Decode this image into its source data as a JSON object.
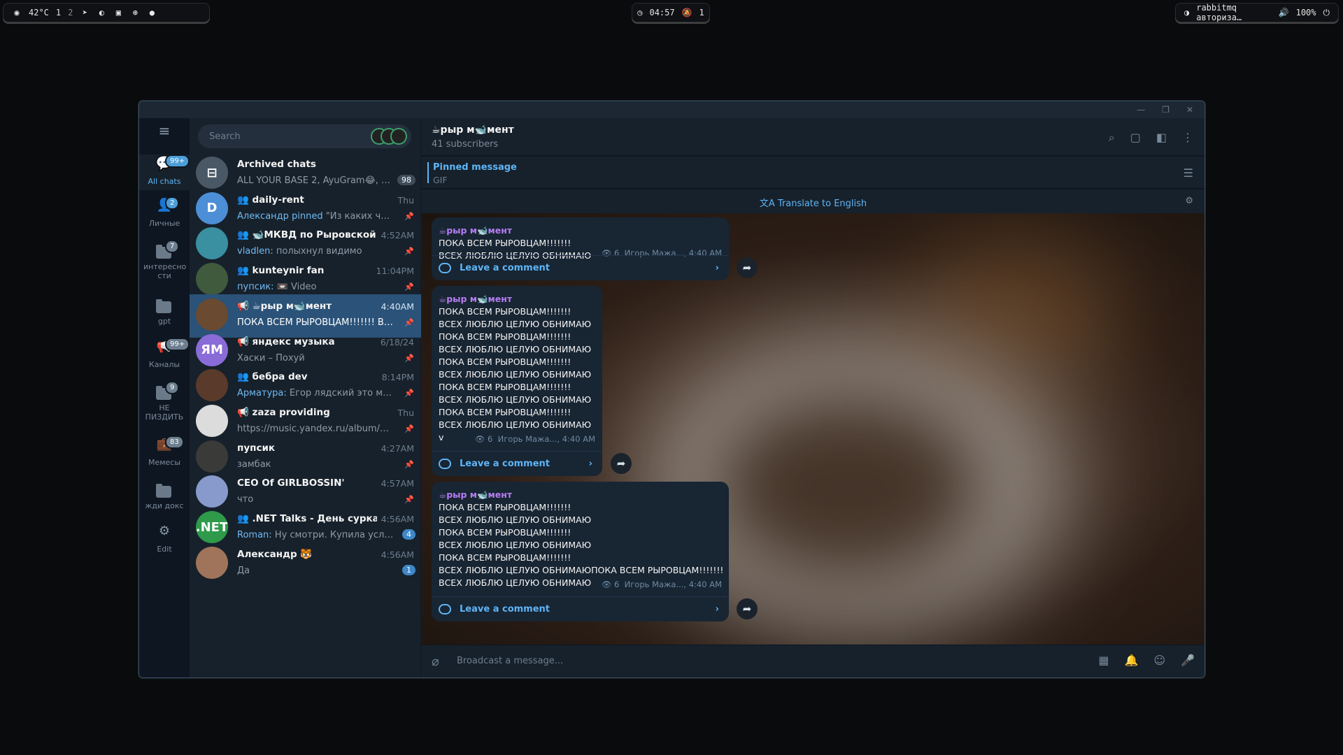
{
  "topbar": {
    "temp": "42°C",
    "ws1": "1",
    "ws2": "2",
    "clock": "04:57",
    "notif_count": "1",
    "tray_text": "rabbitmq авториза…",
    "volume": "100%"
  },
  "rail": {
    "items": [
      {
        "label": "All chats",
        "badge": "99+"
      },
      {
        "label": "Личные",
        "badge": "2"
      },
      {
        "label": "интересно сти",
        "badge": "7"
      },
      {
        "label": "gpt",
        "badge": ""
      },
      {
        "label": "Каналы",
        "badge": "99+"
      },
      {
        "label": "НЕ ПИЗДИТЬ",
        "badge": "9"
      },
      {
        "label": "Мемесы",
        "badge": "83"
      },
      {
        "label": "жди докс",
        "badge": ""
      },
      {
        "label": "Edit",
        "badge": ""
      }
    ]
  },
  "search": {
    "placeholder": "Search"
  },
  "chats": [
    {
      "name": "Archived chats",
      "time": "",
      "preview": "ALL YOUR BASE 2, AyuGram😂, NS…",
      "count": "98",
      "avatar": "⊟",
      "color": "#4a5866"
    },
    {
      "name": "👥 daily-rent",
      "time": "Thu",
      "sender": "Александр pinned ",
      "preview": "\"Из каких часте…",
      "avatar": "D",
      "color": "#4c8fd6"
    },
    {
      "name": "👥 🐋МКВД по Рыровской О…",
      "time": "4:52AM",
      "sender": "vladlen: ",
      "preview": "полыхнул видимо",
      "avatar": "",
      "color": "#3a8fa0"
    },
    {
      "name": "👥 kunteynir fan",
      "time": "11:04PM",
      "sender": "пупсик: ",
      "preview": "📼 Video",
      "avatar": "",
      "color": "#3f5a3c"
    },
    {
      "name": "📢 ☕рыр м🐋мент",
      "time": "4:40AM",
      "sender": "",
      "preview": "ПОКА ВСЕМ РЫРОВЦАМ!!!!!!! ВСЕХ …",
      "avatar": "",
      "color": "#6a4a30"
    },
    {
      "name": "📢 яндекс музыка",
      "time": "6/18/24",
      "sender": "",
      "preview": "Хаски – Похуй",
      "avatar": "ЯМ",
      "color": "#8a6cd8"
    },
    {
      "name": "👥 бебра dev",
      "time": "8:14PM",
      "sender": "Арматура: ",
      "preview": "Егор лядский это моя з…",
      "avatar": "",
      "color": "#5a3a2a"
    },
    {
      "name": "📢 zaza providing",
      "time": "Thu",
      "sender": "",
      "preview": "https://music.yandex.ru/album/320…",
      "avatar": "",
      "color": "#dcdcdc"
    },
    {
      "name": "пупсик",
      "time": "4:27AM",
      "sender": "",
      "preview": "замбак",
      "avatar": "",
      "color": "#3a3a38"
    },
    {
      "name": "CEO Of GIRLBOSSIN'",
      "time": "4:57AM",
      "sender": "",
      "preview": "что",
      "avatar": "",
      "color": "#8899cc"
    },
    {
      "name": "👥 .NET Talks - День сурка",
      "time": "4:56AM",
      "sender": "Roman: ",
      "preview": "Ну смотри. Купила условн…",
      "count": "4",
      "avatar": ".NET",
      "color": "#2e9a4a"
    },
    {
      "name": "Александр 🐯",
      "time": "4:56AM",
      "sender": "",
      "preview": "Да",
      "count": "1",
      "avatar": "",
      "color": "#a0745a"
    }
  ],
  "channel": {
    "title": "☕рыр м🐋мент",
    "subs": "41 subscribers",
    "pinned_label": "Pinned message",
    "pinned_text": "GIF",
    "translate": "Translate to English",
    "composer_placeholder": "Broadcast a message..."
  },
  "messages": [
    {
      "author": "☕рыр м🐋мент",
      "text": "ПОКА ВСЕМ РЫРОВЦАМ!!!!!!!\nВСЕХ ЛЮБЛЮ ЦЕЛУЮ ОБНИМАЮ",
      "views": "6",
      "meta": "Игорь Мажа..., 4:40 AM",
      "comment": "Leave a comment"
    },
    {
      "author": "☕рыр м🐋мент",
      "text": "ПОКА ВСЕМ РЫРОВЦАМ!!!!!!!\nВСЕХ ЛЮБЛЮ ЦЕЛУЮ ОБНИМАЮ\nПОКА ВСЕМ РЫРОВЦАМ!!!!!!!\nВСЕХ ЛЮБЛЮ ЦЕЛУЮ ОБНИМАЮ\nПОКА ВСЕМ РЫРОВЦАМ!!!!!!!\nВСЕХ ЛЮБЛЮ ЦЕЛУЮ ОБНИМАЮ\nПОКА ВСЕМ РЫРОВЦАМ!!!!!!!\nВСЕХ ЛЮБЛЮ ЦЕЛУЮ ОБНИМАЮ\nПОКА ВСЕМ РЫРОВЦАМ!!!!!!!\nВСЕХ ЛЮБЛЮ ЦЕЛУЮ ОБНИМАЮ\nv",
      "views": "6",
      "meta": "Игорь Мажа..., 4:40 AM",
      "comment": "Leave a comment"
    },
    {
      "author": "☕рыр м🐋мент",
      "text": "ПОКА ВСЕМ РЫРОВЦАМ!!!!!!!\nВСЕХ ЛЮБЛЮ ЦЕЛУЮ ОБНИМАЮ\nПОКА ВСЕМ РЫРОВЦАМ!!!!!!!\nВСЕХ ЛЮБЛЮ ЦЕЛУЮ ОБНИМАЮ\nПОКА ВСЕМ РЫРОВЦАМ!!!!!!!\nВСЕХ ЛЮБЛЮ ЦЕЛУЮ ОБНИМАЮПОКА ВСЕМ РЫРОВЦАМ!!!!!!!\nВСЕХ ЛЮБЛЮ ЦЕЛУЮ ОБНИМАЮ",
      "views": "6",
      "meta": "Игорь Мажа..., 4:40 AM",
      "comment": "Leave a comment"
    }
  ]
}
